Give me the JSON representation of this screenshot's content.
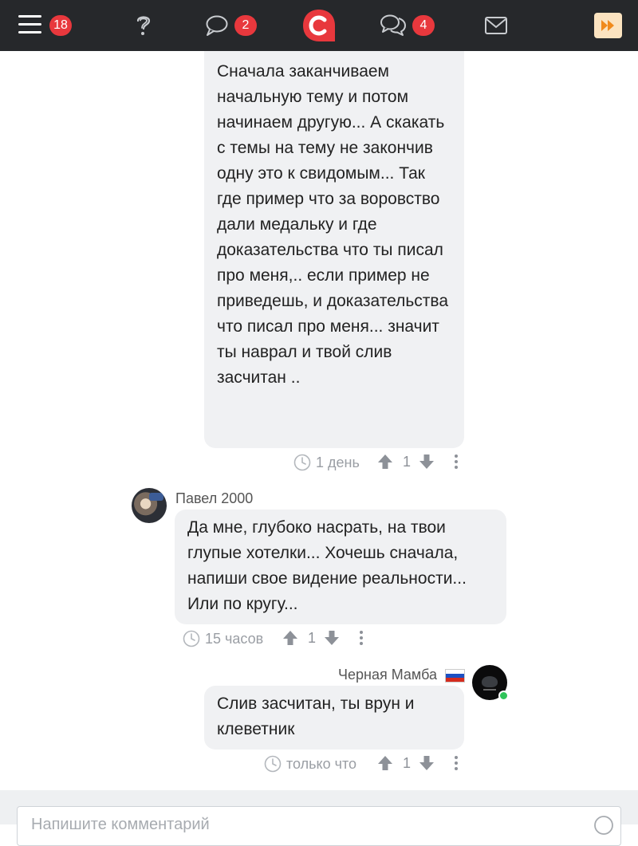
{
  "topbar": {
    "menu_badge": "18",
    "chat_badge": "2",
    "forum_badge": "4",
    "colors": {
      "background": "#26282b",
      "badge": "#e8383d",
      "brand": "#e8383d",
      "accent": "#f5a623"
    }
  },
  "comments": [
    {
      "side": "right",
      "author": "",
      "text": "Сначала заканчиваем начальную тему и потом начинаем другую... А скакать с темы на тему не закончив одну это к свидомым... Так где пример что за воровство дали медальку и где доказательства что ты писал про меня,.. если пример не приведешь, и доказательства что писал про меня... значит ты наврал и твой слив засчитан ..",
      "time": "1 день",
      "score": "1"
    },
    {
      "side": "left",
      "author": "Павел 2000",
      "text": "Да мне, глубоко насрать, на твои глупые хотелки... Хочешь сначала, напиши свое видение реальности... Или по кругу...",
      "time": "15 часов",
      "score": "1"
    },
    {
      "side": "right",
      "author": "Черная Мамба",
      "text": "Слив засчитан, ты врун и клеветник",
      "time": "только что",
      "score": "1"
    }
  ],
  "composer": {
    "placeholder": "Напишите комментарий"
  }
}
